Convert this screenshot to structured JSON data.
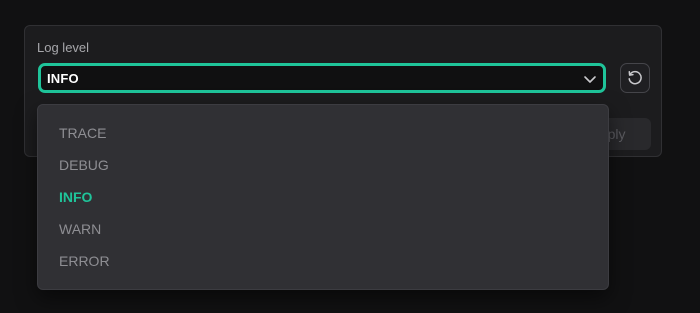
{
  "field": {
    "label": "Log level",
    "selected_value": "INFO"
  },
  "buttons": {
    "reset_icon": "refresh-icon",
    "apply_label": "Apply"
  },
  "dropdown": {
    "options": [
      "TRACE",
      "DEBUG",
      "INFO",
      "WARN",
      "ERROR"
    ],
    "selected_index": 2
  },
  "colors": {
    "accent": "#1fc49a",
    "background": "#111112",
    "card": "#1c1c1e",
    "dropdown": "#303034",
    "option_text": "#8e8e93"
  }
}
